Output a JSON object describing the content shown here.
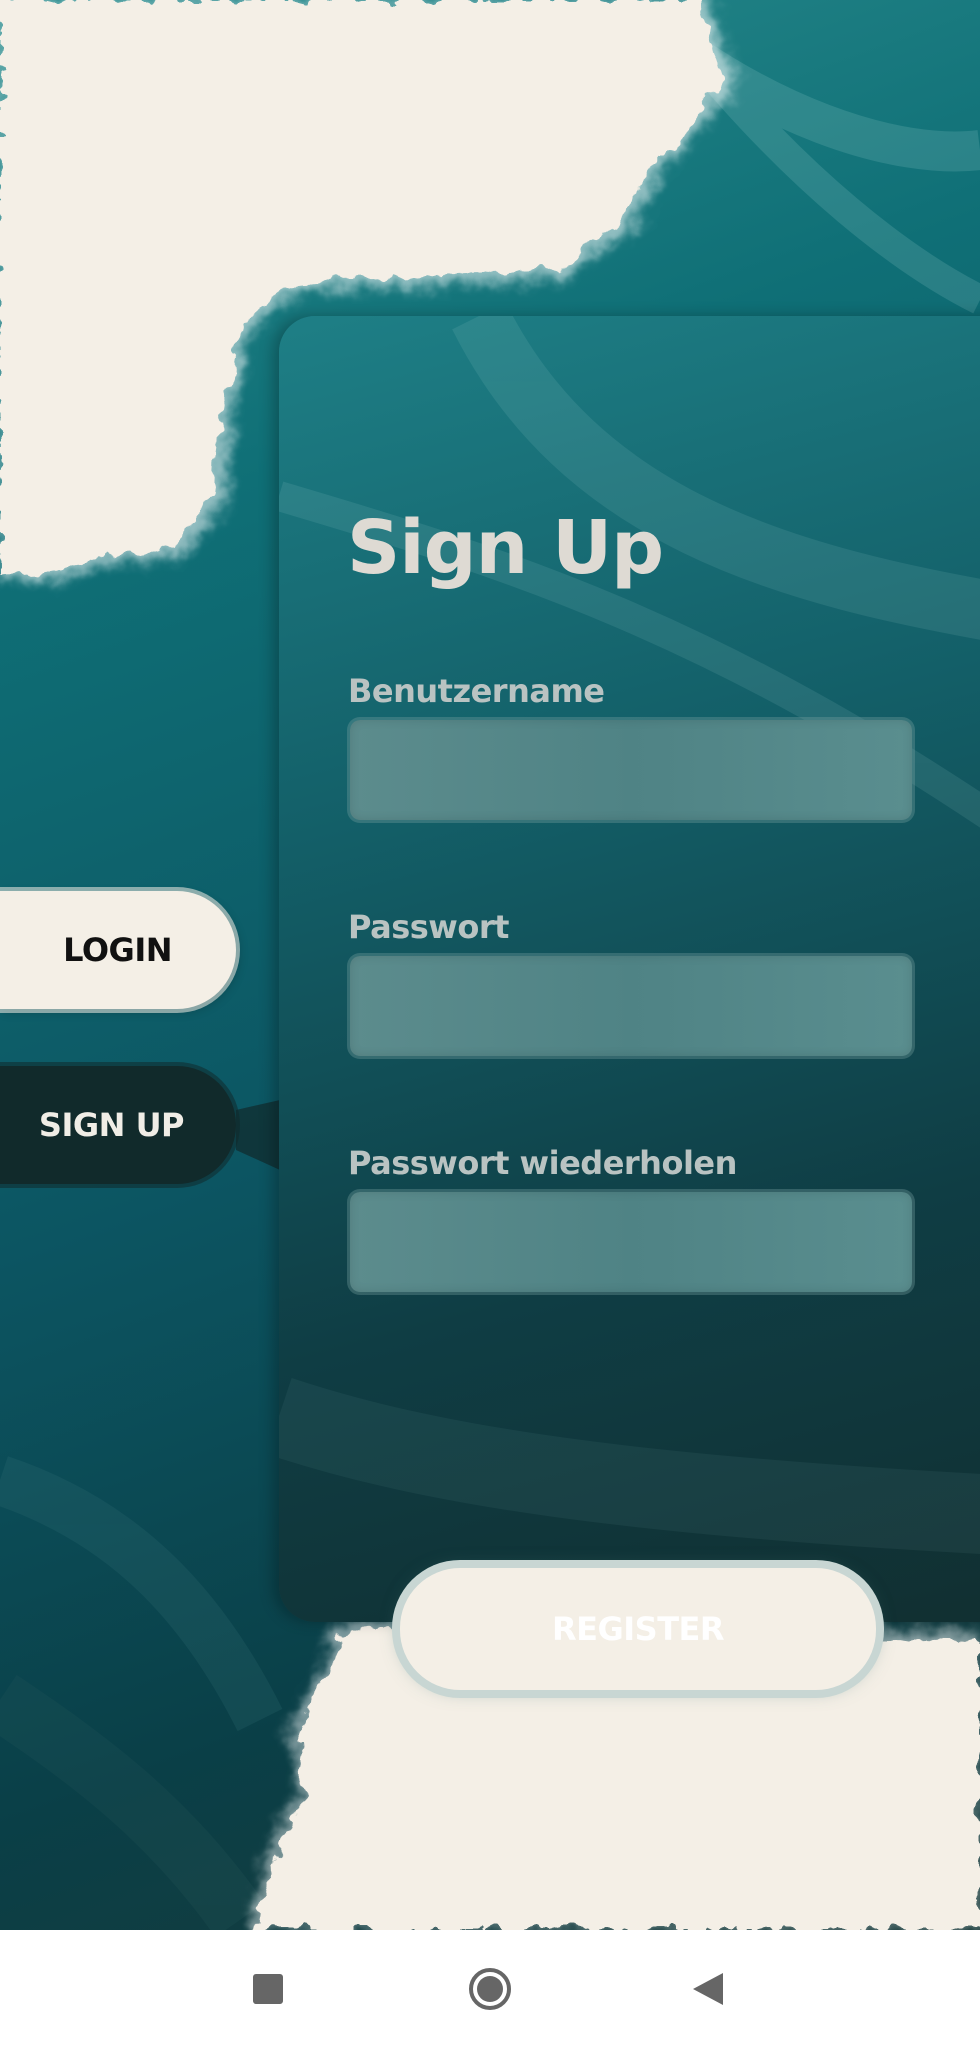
{
  "signup": {
    "title": "Sign Up",
    "username_label": "Benutzername",
    "username_value": "",
    "password_label": "Passwort",
    "password_value": "",
    "password_repeat_label": "Passwort wiederholen",
    "password_repeat_value": "",
    "register_label": "REGISTER"
  },
  "side_tabs": {
    "login_label": "LOGIN",
    "signup_label": "SIGN UP",
    "active": "signup"
  },
  "colors": {
    "teal_background": "#0f6f76",
    "panel": "#135f68",
    "paper": "#f4efe6",
    "dark_tab": "#112a2b"
  },
  "system_nav": {
    "recents_icon": "square-stop-icon",
    "home_icon": "circle-home-icon",
    "back_icon": "triangle-back-icon"
  }
}
